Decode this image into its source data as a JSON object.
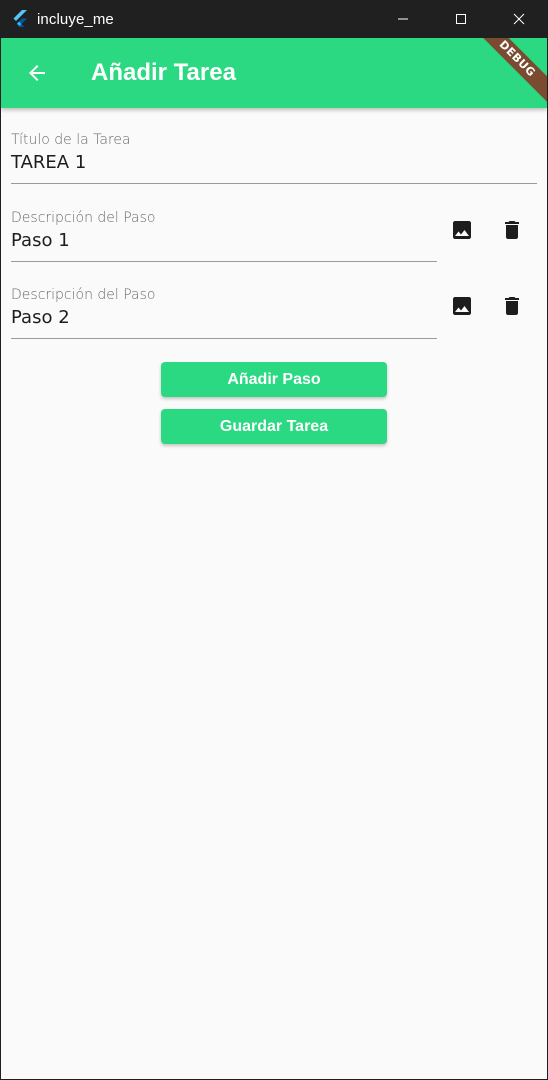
{
  "window": {
    "title": "incluye_me",
    "app_icon": "flutter-icon",
    "controls": [
      "minimize-icon",
      "maximize-icon",
      "close-icon"
    ]
  },
  "appbar": {
    "title": "Añadir Tarea",
    "back_icon": "arrow-back-icon",
    "background": "#2bd982",
    "debug_banner": "DEBUG"
  },
  "form": {
    "task_title": {
      "label": "Título de la Tarea",
      "value": "TAREA 1"
    },
    "steps": [
      {
        "label": "Descripción del Paso",
        "value": "Paso 1",
        "image_icon": "image-icon",
        "delete_icon": "trash-icon"
      },
      {
        "label": "Descripción del Paso",
        "value": "Paso 2",
        "image_icon": "image-icon",
        "delete_icon": "trash-icon"
      }
    ]
  },
  "actions": {
    "add_step_label": "Añadir Paso",
    "save_task_label": "Guardar Tarea"
  }
}
